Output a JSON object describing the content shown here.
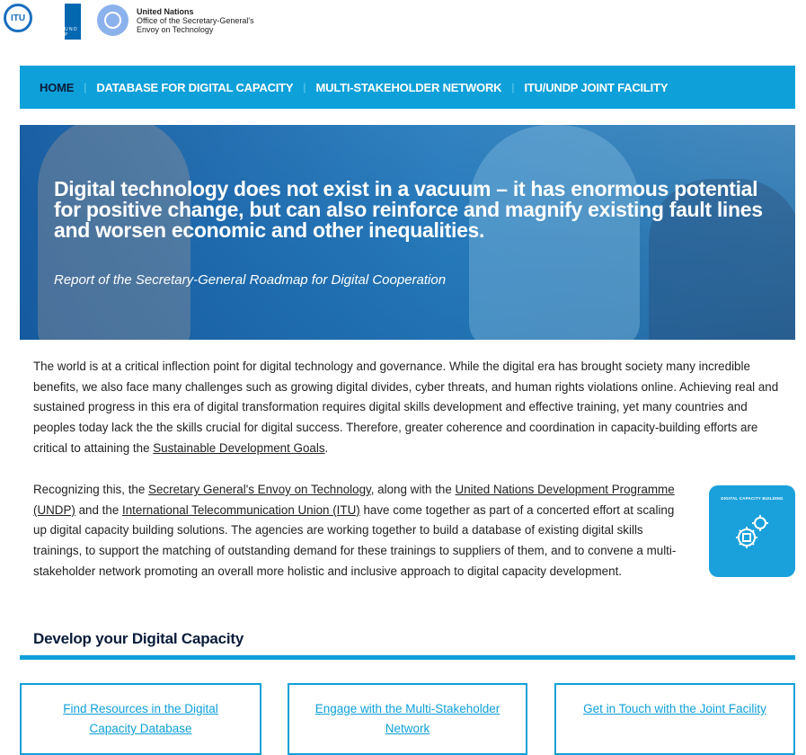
{
  "header": {
    "logos": {
      "itu": "ITU",
      "undp": "U N D P",
      "un_line1": "United Nations",
      "un_line2": "Office of the Secretary-General's",
      "un_line3": "Envoy on Technology"
    }
  },
  "nav": {
    "items": [
      {
        "label": "HOME"
      },
      {
        "label": "DATABASE FOR DIGITAL CAPACITY"
      },
      {
        "label": "MULTI-STAKEHOLDER NETWORK"
      },
      {
        "label": "ITU/UNDP JOINT FACILITY"
      }
    ],
    "separator": "|"
  },
  "hero": {
    "quote": "Digital technology does not exist in a vacuum – it has enormous potential for positive change, but can also reinforce and magnify existing fault lines and worsen economic and other inequalities.",
    "citation": "Report of the Secretary-General Roadmap for Digital Cooperation"
  },
  "intro": {
    "para1_text": "The world is at a critical inflection point for digital technology and governance. While the digital era has brought society many incredible benefits, we also face many challenges such as growing digital divides, cyber threats, and human rights violations online. Achieving real and sustained progress in this era of digital transformation requires digital skills development and effective training, yet many countries and peoples today lack the the skills crucial for digital success. Therefore, greater coherence and coordination in capacity-building efforts are critical to attaining the ",
    "para1_link": "Sustainable Development Goals",
    "para1_end": ".",
    "para2_a": "Recognizing this, the ",
    "para2_link1": "Secretary General's Envoy on Technology",
    "para2_b": ", along with the ",
    "para2_link2": "United Nations Development Programme (UNDP)",
    "para2_c": " and the ",
    "para2_link3": "International Telecommunication Union (ITU)",
    "para2_d": " have come together as part of a concerted effort at scaling up digital capacity building solutions. The agencies are working together to build a database of existing digital skills trainings, to support the matching of outstanding demand for these trainings to suppliers of them, and to convene a multi-stakeholder network promoting an overall more holistic and inclusive approach to digital capacity development.",
    "badge_label": "DIGITAL CAPACITY BUILDING"
  },
  "develop": {
    "heading": "Develop your Digital Capacity",
    "cta": [
      {
        "label": "Find Resources in the Digital Capacity Database"
      },
      {
        "label": "Engage with the Multi-Stakeholder Network"
      },
      {
        "label": "Get in Touch with the Joint Facility"
      }
    ]
  },
  "colors": {
    "accent": "#0ea0d9",
    "nav_active": "#0a1c3a",
    "hero_overlay": "#1e6fb4"
  }
}
